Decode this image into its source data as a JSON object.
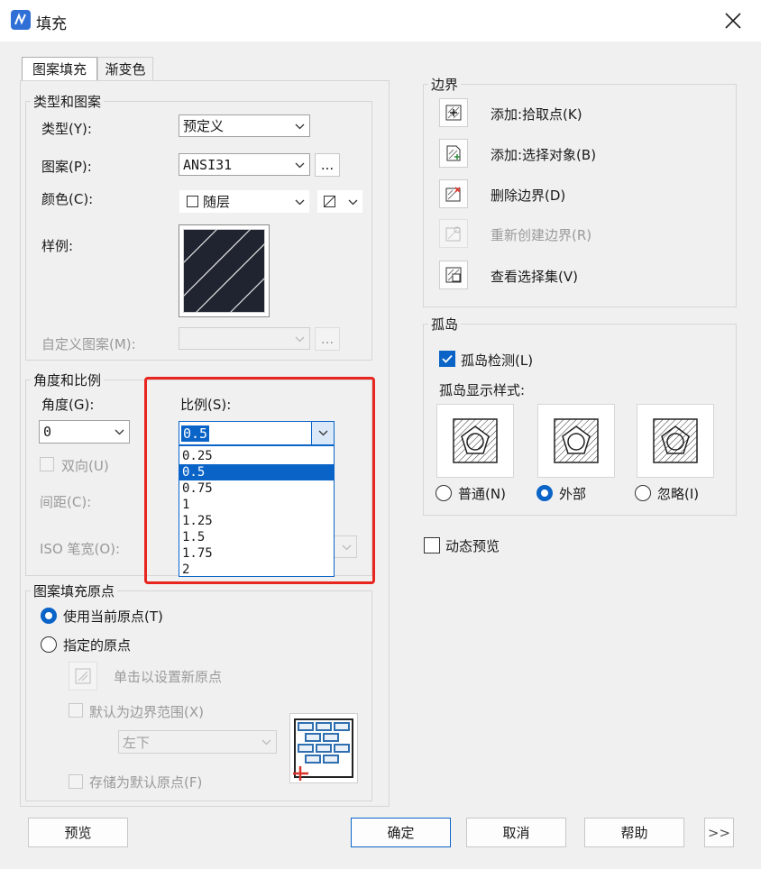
{
  "window": {
    "title": "填充"
  },
  "tabs": [
    {
      "label": "图案填充",
      "active": true
    },
    {
      "label": "渐变色",
      "active": false
    }
  ],
  "type_pattern": {
    "group_label": "类型和图案",
    "type_label": "类型(Y):",
    "type_value": "预定义",
    "pattern_label": "图案(P):",
    "pattern_value": "ANSI31",
    "pattern_browse": "...",
    "color_label": "颜色(C):",
    "color_value": "随层",
    "sample_label": "样例:",
    "custom_label": "自定义图案(M):",
    "custom_browse": "..."
  },
  "angle_scale": {
    "group_label": "角度和比例",
    "angle_label": "角度(G):",
    "angle_value": "0",
    "scale_label": "比例(S):",
    "scale_value": "0.5",
    "scale_options": [
      "0.25",
      "0.5",
      "0.75",
      "1",
      "1.25",
      "1.5",
      "1.75",
      "2"
    ],
    "scale_selected": "0.5",
    "double_label": "双向(U)",
    "spacing_label": "间距(C):",
    "iso_label": "ISO 笔宽(O):"
  },
  "origin": {
    "group_label": "图案填充原点",
    "use_current_label": "使用当前原点(T)",
    "specified_label": "指定的原点",
    "click_set_label": "单击以设置新原点",
    "default_extent_label": "默认为边界范围(X)",
    "position_value": "左下",
    "store_default_label": "存储为默认原点(F)"
  },
  "boundary": {
    "group_label": "边界",
    "items": [
      {
        "label": "添加:拾取点(K)",
        "icon": "pick-points-icon",
        "enabled": true
      },
      {
        "label": "添加:选择对象(B)",
        "icon": "select-objects-icon",
        "enabled": true
      },
      {
        "label": "删除边界(D)",
        "icon": "remove-boundary-icon",
        "enabled": true
      },
      {
        "label": "重新创建边界(R)",
        "icon": "recreate-boundary-icon",
        "enabled": false
      },
      {
        "label": "查看选择集(V)",
        "icon": "view-selection-icon",
        "enabled": true
      }
    ]
  },
  "islands": {
    "group_label": "孤岛",
    "detect_label": "孤岛检测(L)",
    "detect_checked": true,
    "style_label": "孤岛显示样式:",
    "styles": [
      {
        "label": "普通(N)",
        "checked": false
      },
      {
        "label": "外部",
        "checked": true
      },
      {
        "label": "忽略(I)",
        "checked": false
      }
    ]
  },
  "preview_dynamic": {
    "label": "动态预览",
    "checked": false
  },
  "footer": {
    "preview": "预览",
    "ok": "确定",
    "cancel": "取消",
    "help": "帮助",
    "more": ">>"
  },
  "colors": {
    "accent": "#0a64c8",
    "highlight_border": "#e8261f",
    "sample_bg": "#1f2430"
  }
}
